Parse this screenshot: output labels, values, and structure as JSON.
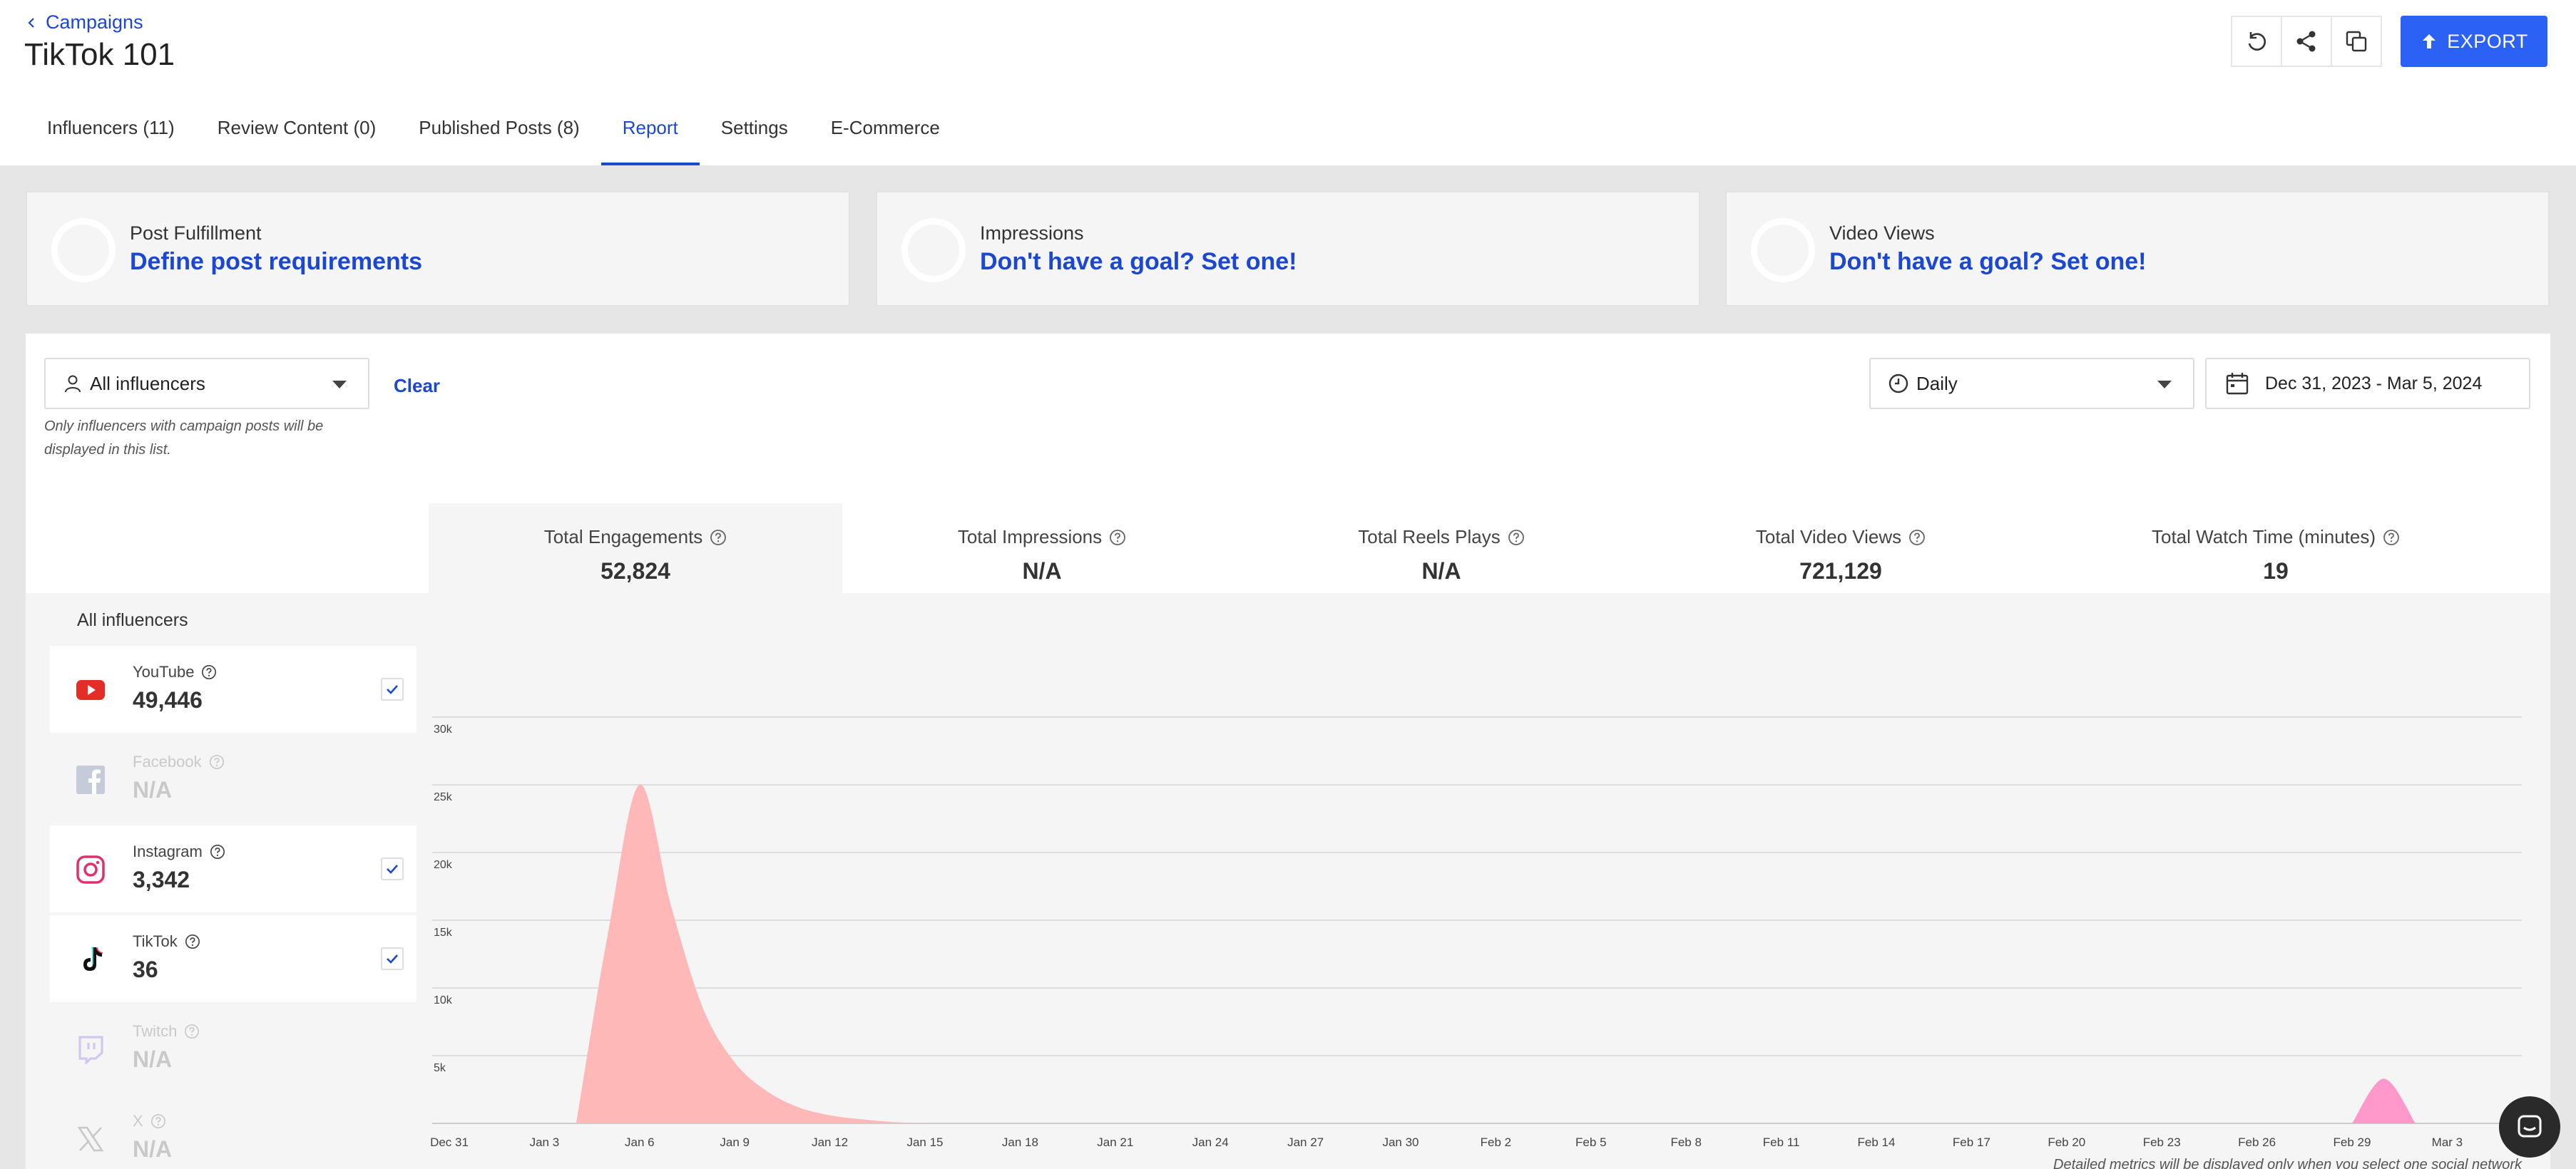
{
  "header": {
    "back_label": "Campaigns",
    "title": "TikTok 101",
    "export_label": "EXPORT",
    "toolbar_icons": [
      "refresh-icon",
      "share-icon",
      "copy-icon"
    ]
  },
  "tabs": [
    {
      "label": "Influencers (11)",
      "active": false
    },
    {
      "label": "Review Content (0)",
      "active": false
    },
    {
      "label": "Published Posts (8)",
      "active": false
    },
    {
      "label": "Report",
      "active": true
    },
    {
      "label": "Settings",
      "active": false
    },
    {
      "label": "E-Commerce",
      "active": false
    }
  ],
  "goals": [
    {
      "label": "Post Fulfillment",
      "link": "Define post requirements"
    },
    {
      "label": "Impressions",
      "link": "Don't have a goal? Set one!"
    },
    {
      "label": "Video Views",
      "link": "Don't have a goal? Set one!"
    }
  ],
  "filters": {
    "influencer_select": "All influencers",
    "clear_label": "Clear",
    "hint": "Only influencers with campaign posts will be displayed in this list.",
    "interval_select": "Daily",
    "date_range": "Dec 31, 2023 - Mar 5, 2024"
  },
  "metrics": [
    {
      "label": "Total Engagements",
      "value": "52,824",
      "active": true
    },
    {
      "label": "Total Impressions",
      "value": "N/A",
      "active": false
    },
    {
      "label": "Total Reels Plays",
      "value": "N/A",
      "active": false
    },
    {
      "label": "Total Video Views",
      "value": "721,129",
      "active": false
    },
    {
      "label": "Total Watch Time (minutes)",
      "value": "19",
      "active": false
    }
  ],
  "networks": {
    "title": "All influencers",
    "items": [
      {
        "name": "YouTube",
        "value": "49,446",
        "enabled": true,
        "checked": true,
        "icon": "youtube-icon"
      },
      {
        "name": "Facebook",
        "value": "N/A",
        "enabled": false,
        "checked": false,
        "icon": "facebook-icon"
      },
      {
        "name": "Instagram",
        "value": "3,342",
        "enabled": true,
        "checked": true,
        "icon": "instagram-icon"
      },
      {
        "name": "TikTok",
        "value": "36",
        "enabled": true,
        "checked": true,
        "icon": "tiktok-icon"
      },
      {
        "name": "Twitch",
        "value": "N/A",
        "enabled": false,
        "checked": false,
        "icon": "twitch-icon"
      },
      {
        "name": "X",
        "value": "N/A",
        "enabled": false,
        "checked": false,
        "icon": "x-icon"
      }
    ]
  },
  "chart_data": {
    "type": "area",
    "title": "",
    "xlabel": "",
    "ylabel": "",
    "ylim": [
      0,
      30000
    ],
    "y_ticks": [
      "5k",
      "10k",
      "15k",
      "20k",
      "25k",
      "30k"
    ],
    "x_tick_labels": [
      "Dec 31",
      "Jan 3",
      "Jan 6",
      "Jan 9",
      "Jan 12",
      "Jan 15",
      "Jan 18",
      "Jan 21",
      "Jan 24",
      "Jan 27",
      "Jan 30",
      "Feb 2",
      "Feb 5",
      "Feb 8",
      "Feb 11",
      "Feb 14",
      "Feb 17",
      "Feb 20",
      "Feb 23",
      "Feb 26",
      "Feb 29",
      "Mar 3"
    ],
    "grid": true,
    "series": [
      {
        "color": "#ffb8b8",
        "x": [
          "Jan 4",
          "Jan 5",
          "Jan 6",
          "Jan 7",
          "Jan 8",
          "Jan 9",
          "Jan 10",
          "Jan 11",
          "Jan 12",
          "Jan 13",
          "Jan 14",
          "Jan 15"
        ],
        "values": [
          0,
          14000,
          25000,
          16000,
          8500,
          4500,
          2400,
          1200,
          600,
          300,
          100,
          0
        ]
      },
      {
        "color": "#ff99cc",
        "x": [
          "Feb 29",
          "Mar 1",
          "Mar 2"
        ],
        "values": [
          0,
          3300,
          0
        ]
      }
    ],
    "note": "Detailed metrics will be displayed only when you select one social network"
  },
  "colors": {
    "accent": "#1c47d1",
    "export_button": "#2b61f5"
  }
}
